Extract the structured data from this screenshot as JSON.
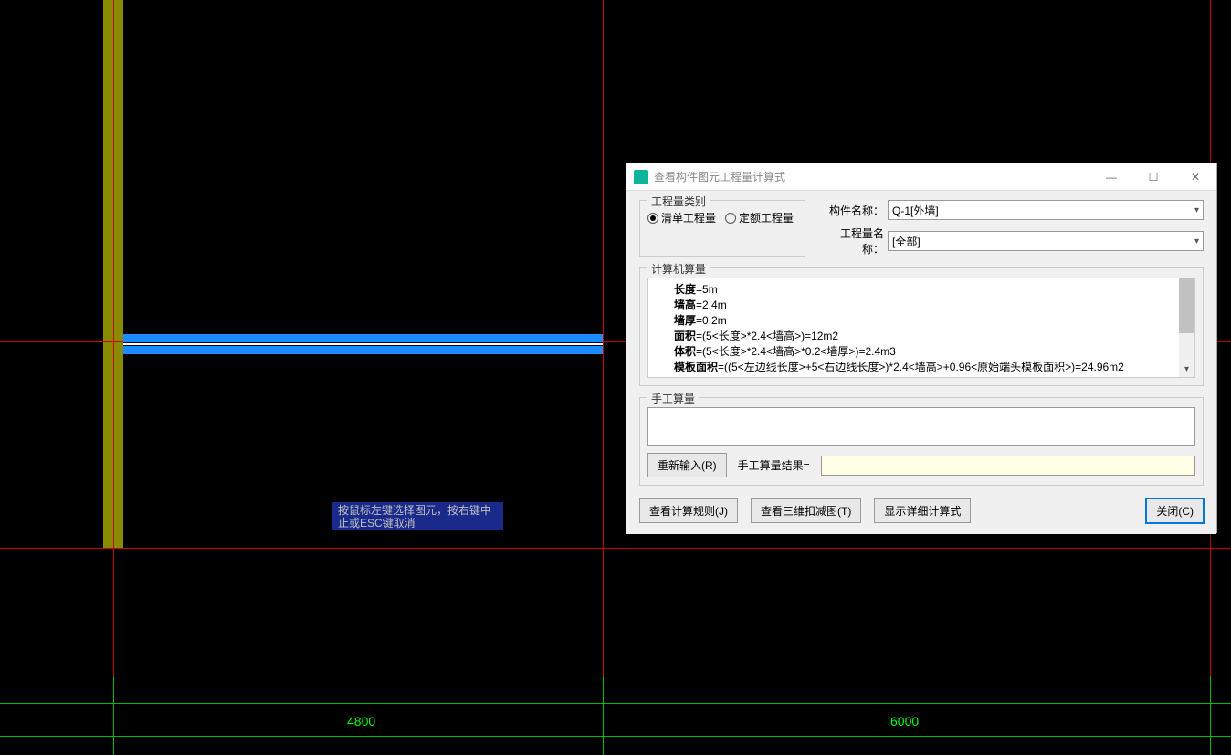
{
  "canvas": {
    "dimensions": {
      "left": "4800",
      "right": "6000"
    },
    "tooltip": "按鼠标左键选择图元，按右键中止或ESC键取消"
  },
  "dialog": {
    "title": "查看构件图元工程量计算式",
    "type_group_label": "工程量类别",
    "radio_list": "清单工程量",
    "radio_quota": "定额工程量",
    "component_label": "构件名称：",
    "component_value": "Q-1[外墙]",
    "quantity_label": "工程量名称：",
    "quantity_value": "[全部]",
    "calc_group_label": "计算机算量",
    "calc_lines": {
      "l1_b": "长度",
      "l1_v": "=5m",
      "l2_b": "墙高",
      "l2_v": "=2.4m",
      "l3_b": "墙厚",
      "l3_v": "=0.2m",
      "l4_b": "面积",
      "l4_v": "=(5<长度>*2.4<墙高>)=12m2",
      "l5_b": "体积",
      "l5_v": "=(5<长度>*2.4<墙高>*0.2<墙厚>)=2.4m3",
      "l6_b": "模板面积",
      "l6_v": "=((5<左边线长度>+5<右边线长度>)*2.4<墙高>+0.96<原始端头模板面积>)=24.96m2"
    },
    "manual_group_label": "手工算量",
    "reinput_btn": "重新输入(R)",
    "result_label": "手工算量结果=",
    "rule_btn": "查看计算规则(J)",
    "view3d_btn": "查看三维扣减图(T)",
    "detail_btn": "显示详细计算式",
    "close_btn": "关闭(C)"
  }
}
